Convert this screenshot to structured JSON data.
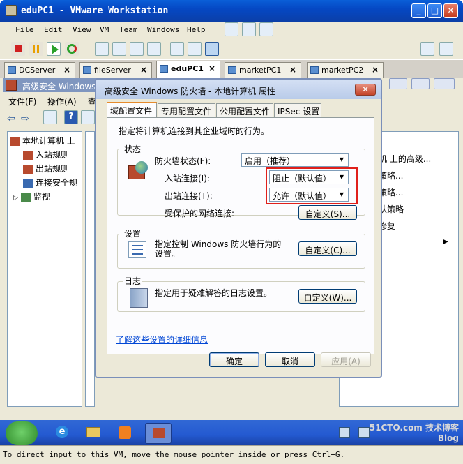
{
  "window": {
    "title": "eduPC1 - VMware Workstation",
    "min": "_",
    "max": "□",
    "close": "✕"
  },
  "menu": [
    "File",
    "Edit",
    "View",
    "VM",
    "Team",
    "Windows",
    "Help"
  ],
  "vm_tabs": [
    {
      "label": "DCServer"
    },
    {
      "label": "fileServer"
    },
    {
      "label": "eduPC1"
    },
    {
      "label": "marketPC1"
    },
    {
      "label": "marketPC2"
    }
  ],
  "mmc": {
    "title": "高级安全 Windows",
    "menu": [
      "文件(F)",
      "操作(A)",
      "查"
    ]
  },
  "tree": {
    "root": "本地计算机 上",
    "items": [
      "入站规则",
      "出站规则",
      "连接安全规",
      "监视"
    ]
  },
  "right_panel": {
    "items": [
      "机 上的高级...",
      "策略...",
      "策略...",
      "认策略",
      "修复"
    ]
  },
  "dialog": {
    "title": "高级安全 Windows 防火墙 - 本地计算机 属性",
    "close": "✕",
    "tabs": [
      "域配置文件",
      "专用配置文件",
      "公用配置文件",
      "IPSec 设置"
    ],
    "description": "指定将计算机连接到其企业域时的行为。",
    "state_group": "状态",
    "firewall_state_label": "防火墙状态(F):",
    "firewall_state_value": "启用（推荐）",
    "inbound_label": "入站连接(I):",
    "inbound_value": "阻止（默认值）",
    "outbound_label": "出站连接(T):",
    "outbound_value": "允许（默认值）",
    "protected_label": "受保护的网络连接:",
    "custom_s": "自定义(S)...",
    "settings_group": "设置",
    "settings_text": "指定控制 Windows 防火墙行为的设置。",
    "custom_c": "自定义(C)...",
    "log_group": "日志",
    "log_text": "指定用于疑难解答的日志设置。",
    "custom_w": "自定义(W)...",
    "learn_more": "了解这些设置的详细信息",
    "ok": "确定",
    "cancel": "取消",
    "apply": "应用(A)"
  },
  "status_bar": "To direct input to this VM, move the mouse pointer inside or press Ctrl+G.",
  "watermark": "51CTO.com 技术博客 Blog"
}
